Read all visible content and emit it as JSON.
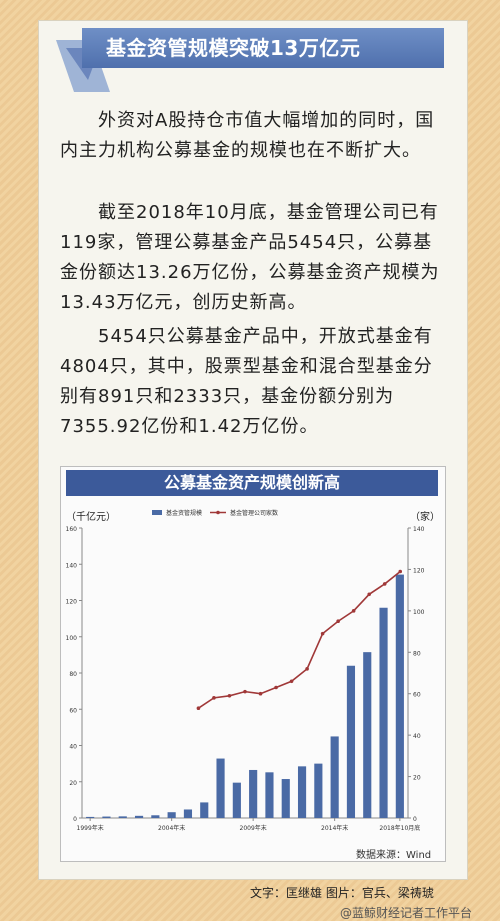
{
  "header": {
    "title": "基金资管规模突破13万亿元"
  },
  "body": {
    "p1": "外资对A股持仓市值大幅增加的同时，国内主力机构公募基金的规模也在不断扩大。",
    "p2": "截至2018年10月底，基金管理公司已有119家，管理公募基金产品5454只，公募基金份额达13.26万亿份，公募基金资产规模为13.43万亿元，创历史新高。",
    "p3": "5454只公募基金产品中，开放式基金有4804只，其中，股票型基金和混合型基金分别有891只和2333只，基金份额分别为7355.92亿份和1.42万亿份。"
  },
  "chart_data": {
    "type": "bar+line",
    "title": "公募基金资产规模创新高",
    "y_left_unit": "（千亿元）",
    "y_right_unit": "（家）",
    "ylim_left": [
      0,
      160
    ],
    "ylim_right": [
      0,
      140
    ],
    "yticks_left": [
      "0",
      "20",
      "40",
      "60",
      "80",
      "100",
      "120",
      "140",
      "160"
    ],
    "yticks_right": [
      "0",
      "20",
      "40",
      "60",
      "80",
      "100",
      "120",
      "140"
    ],
    "x_labels": [
      "1999年末",
      "2004年末",
      "2009年末",
      "2014年末",
      "2018年10月底"
    ],
    "x_label_indices": [
      0,
      5,
      10,
      15,
      19
    ],
    "legend_position": "top",
    "grid": false,
    "series": [
      {
        "name": "基金资管规模",
        "type": "bar",
        "color": "#4a6aa5",
        "values": [
          0.6,
          0.8,
          0.9,
          1.2,
          1.5,
          3.2,
          4.7,
          8.6,
          32.8,
          19.5,
          26.5,
          25.2,
          21.5,
          28.5,
          30.0,
          45.0,
          84.0,
          91.5,
          116.0,
          134.3
        ]
      },
      {
        "name": "基金管理公司家数",
        "type": "line",
        "color": "#a03838",
        "values": [
          null,
          null,
          null,
          null,
          null,
          null,
          null,
          53,
          58,
          59,
          61,
          60,
          63,
          66,
          72,
          89,
          95,
          100,
          108,
          113,
          119
        ]
      }
    ]
  },
  "footer": {
    "source": "数据来源：Wind",
    "credit": "文字：匡继雄  图片：官兵、梁祷琥",
    "watermark": "@蓝鲸财经记者工作平台"
  }
}
